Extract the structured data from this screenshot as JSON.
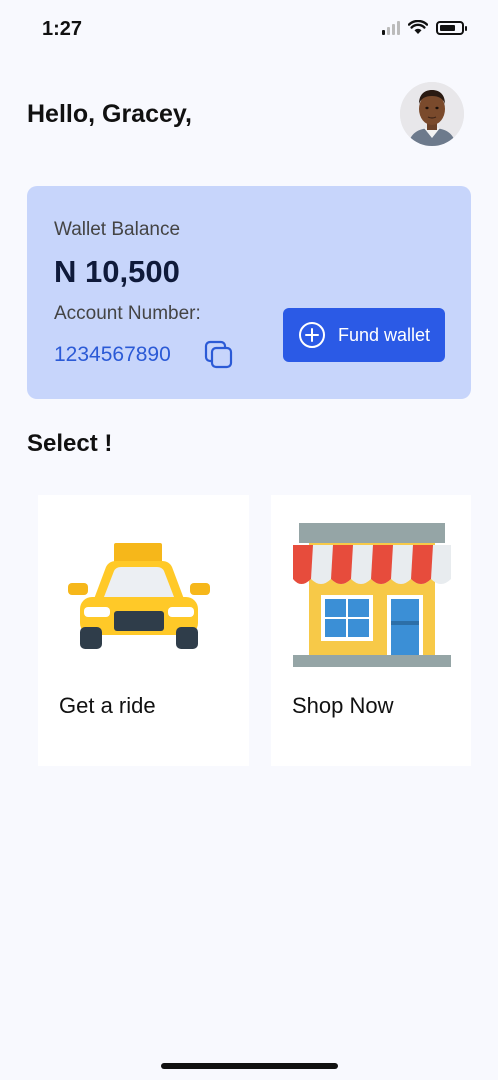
{
  "status_bar": {
    "time": "1:27",
    "battery_level": 0.75
  },
  "header": {
    "greeting": "Hello, Gracey,"
  },
  "wallet": {
    "label": "Wallet Balance",
    "balance": "N 10,500",
    "account_label": "Account Number:",
    "account_number": "1234567890",
    "fund_button_label": "Fund wallet"
  },
  "section": {
    "title": "Select !"
  },
  "options": [
    {
      "label": "Get a ride",
      "icon": "taxi-icon"
    },
    {
      "label": "Shop Now",
      "icon": "storefront-icon"
    }
  ],
  "colors": {
    "background": "#f8f9fe",
    "card": "#c7d5fb",
    "accent": "#2b5ae6",
    "account_text": "#2b5ad6"
  }
}
